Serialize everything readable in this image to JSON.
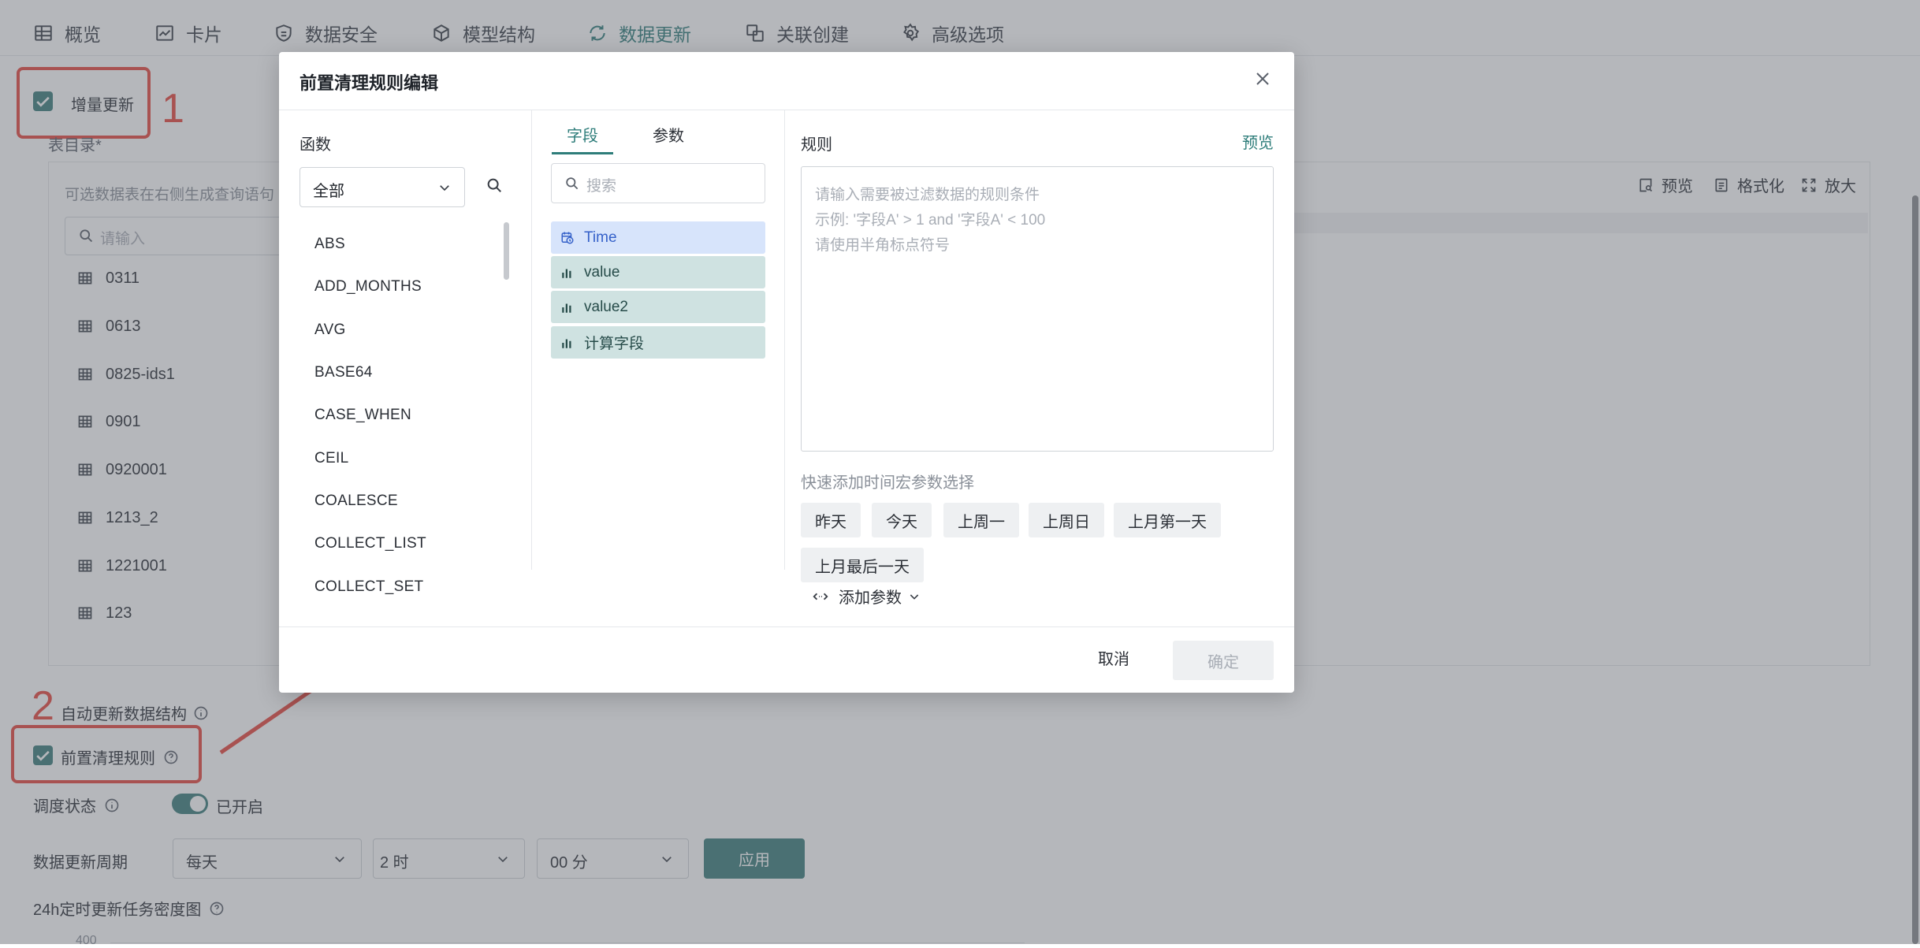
{
  "tabs": [
    "概览",
    "卡片",
    "数据安全",
    "模型结构",
    "数据更新",
    "关联创建",
    "高级选项"
  ],
  "active_tab": "数据更新",
  "incremental_update": {
    "label": "增量更新",
    "checked": true
  },
  "table_dir_label": "表目录*",
  "panel": {
    "hint": "可选数据表在右侧生成查询语句",
    "search_placeholder": "请输入",
    "tables": [
      "0311",
      "0613",
      "0825-ids1",
      "0901",
      "0920001",
      "1213_2",
      "1221001",
      "123"
    ],
    "tools": [
      "预览",
      "格式化",
      "放大"
    ]
  },
  "auto_update_label": "自动更新数据结构",
  "pre_clean": {
    "label": "前置清理规则",
    "checked": true
  },
  "schedule": {
    "label": "调度状态",
    "value": "已开启",
    "on": true
  },
  "period": {
    "label": "数据更新周期",
    "freq": "每天",
    "hour": "2 时",
    "minute": "00 分",
    "apply": "应用"
  },
  "density": {
    "label": "24h定时更新任务密度图",
    "y_top": "400"
  },
  "annotations": [
    "1",
    "2"
  ],
  "modal": {
    "title": "前置清理规则编辑",
    "functions": {
      "title": "函数",
      "filter": "全部",
      "items": [
        "ABS",
        "ADD_MONTHS",
        "AVG",
        "BASE64",
        "CASE_WHEN",
        "CEIL",
        "COALESCE",
        "COLLECT_LIST",
        "COLLECT_SET"
      ]
    },
    "fields": {
      "tabs": [
        "字段",
        "参数"
      ],
      "search_placeholder": "搜索",
      "items": [
        "Time",
        "value",
        "value2",
        "计算字段"
      ]
    },
    "rule": {
      "title": "规则",
      "preview": "预览",
      "placeholder_lines": [
        "请输入需要被过滤数据的规则条件",
        "示例: '字段A' > 1 and '字段A' < 100",
        "请使用半角标点符号"
      ],
      "quick_label": "快速添加时间宏参数选择",
      "chips": [
        "昨天",
        "今天",
        "上周一",
        "上周日",
        "上月第一天",
        "上月最后一天"
      ],
      "add_param": "添加参数"
    },
    "cancel": "取消",
    "ok": "确定"
  },
  "colors": {
    "accent": "#2e7d7a",
    "annotation": "#e8483f",
    "field_bg": "#cfe2e1",
    "time_field_bg": "#d7e4fb"
  }
}
